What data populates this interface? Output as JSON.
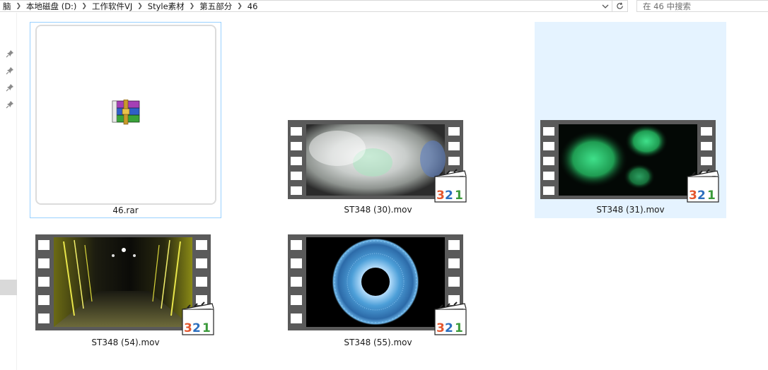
{
  "breadcrumbs": [
    "脑",
    "本地磁盘 (D:)",
    "工作软件VJ",
    "Style素材",
    "第五部分",
    "46"
  ],
  "search": {
    "placeholder": "在 46 中搜索"
  },
  "icons": {
    "refresh": "refresh-icon",
    "dropdown": "chevron-down-icon",
    "search": "search-icon",
    "pin": "pin-icon",
    "archive": "winrar-archive-icon",
    "player": "media-player-classic-321-icon"
  },
  "colors": {
    "selection": "#e5f3ff",
    "focus_border": "#99d1ff",
    "film": "#5a5a5a",
    "badge_3": "#e4572e",
    "badge_2": "#2c6fbe",
    "badge_1": "#3b9a3b"
  },
  "files": [
    {
      "name": "46.rar",
      "type": "archive",
      "state": "focused"
    },
    {
      "name": "ST348 (30).mov",
      "type": "video",
      "thumb": "white-smoke",
      "state": "normal"
    },
    {
      "name": "ST348 (31).mov",
      "type": "video",
      "thumb": "green-smoke",
      "state": "selected"
    },
    {
      "name": "ST348 (54).mov",
      "type": "video",
      "thumb": "yellow-tunnel",
      "state": "normal"
    },
    {
      "name": "ST348 (55).mov",
      "type": "video",
      "thumb": "blue-ring",
      "state": "normal"
    }
  ],
  "badge": {
    "digits": [
      "3",
      "2",
      "1"
    ]
  }
}
